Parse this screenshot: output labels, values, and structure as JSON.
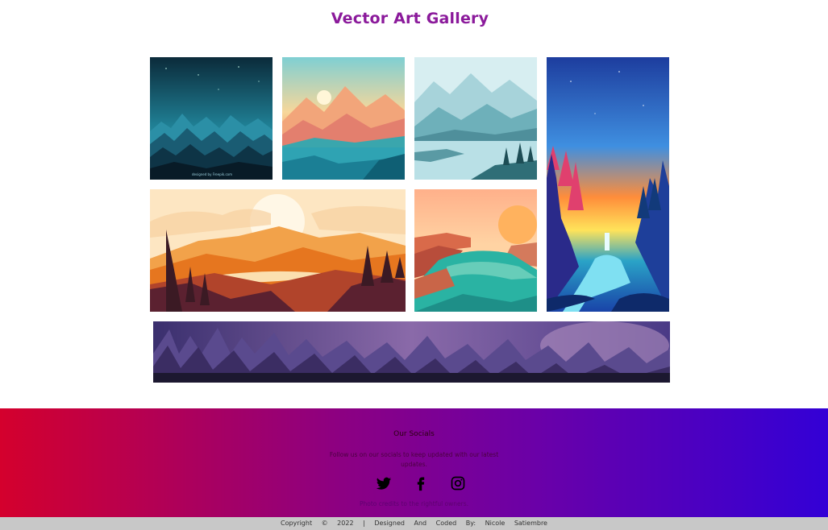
{
  "header": {
    "title": "Vector Art Gallery"
  },
  "gallery": {
    "items": [
      {
        "name": "night-mountains",
        "watermark": "designed by Freepik.com"
      },
      {
        "name": "sunrise-lake"
      },
      {
        "name": "misty-lake"
      },
      {
        "name": "forest-sunset-river"
      },
      {
        "name": "orange-sunset-hills"
      },
      {
        "name": "canyon-river"
      },
      {
        "name": "purple-forest-banner"
      }
    ]
  },
  "footer": {
    "socials_title": "Our Socials",
    "socials_text": "Follow us on our socials to keep updated with our latest updates.",
    "icons": [
      "twitter-icon",
      "facebook-icon",
      "instagram-icon"
    ],
    "credits": "Photo credits to the rightful owners.",
    "copyright": "Copyright © 2022 | Designed And Coded By: Nicole Satiembre"
  }
}
